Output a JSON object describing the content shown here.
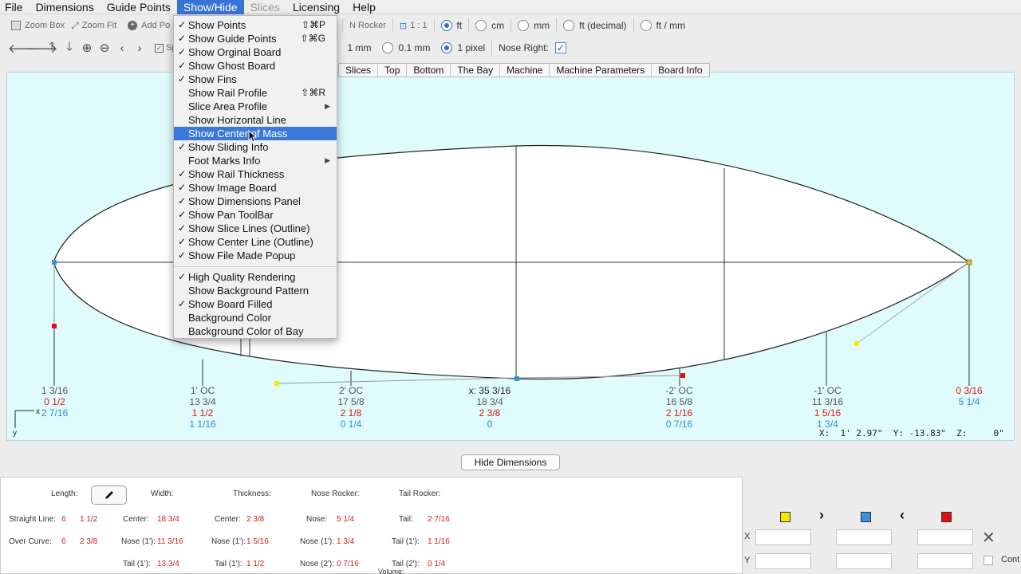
{
  "menubar": {
    "items": [
      "File",
      "Dimensions",
      "Guide Points",
      "Show/Hide",
      "Slices",
      "Licensing",
      "Help"
    ]
  },
  "toolbar1": {
    "zoom_box": "Zoom Box",
    "zoom_fit": "Zoom Fit",
    "add_point": "Add Po",
    "hidden_er": "er",
    "n_rocker": "N Rocker",
    "scale": "1 : 1",
    "units": [
      "ft",
      "cm",
      "mm",
      "ft (decimal)",
      "ft / mm"
    ],
    "selected_unit": "ft"
  },
  "toolbar2": {
    "sp": "Sp",
    "precision": [
      "1 mm",
      "0.1 mm",
      "1 pixel"
    ],
    "selected_precision": "1 pixel",
    "nose_right_label": "Nose Right:",
    "nose_right_checked": true
  },
  "tabs": [
    "Slices",
    "Top",
    "Bottom",
    "The Bay",
    "Machine",
    "Machine Parameters",
    "Board Info"
  ],
  "canvas": {
    "axis_x": "x",
    "axis_y": "y",
    "measurements": [
      {
        "label": "1 3/16",
        "red": "0 1/2",
        "blue": "2 7/16",
        "extra": ""
      },
      {
        "label": "1' OC",
        "gray2": "13 3/4",
        "red": "1 1/2",
        "blue": "1 1/16"
      },
      {
        "label": "2' OC",
        "gray2": "17 5/8",
        "red": "2 1/8",
        "blue": "0 1/4"
      },
      {
        "label": "x: 35 3/16",
        "gray2": "18 3/4",
        "red": "2 3/8",
        "blue": "0"
      },
      {
        "label": "-2' OC",
        "gray2": "16 5/8",
        "red": "2 1/16",
        "blue": "0 7/16"
      },
      {
        "label": "-1' OC",
        "gray2": "11 3/16",
        "red": "1 5/16",
        "blue": "1 3/4"
      },
      {
        "label": "",
        "red": "0 3/16",
        "blue": "5 1/4"
      }
    ],
    "coords_text": "X:  1' 2.97\"  Y: -13.83\"  Z:     0\""
  },
  "hide_dimensions_button": "Hide Dimensions",
  "dimensions_panel": {
    "length_label": "Length:",
    "width_label": "Width:",
    "thickness_label": "Thickness:",
    "nose_rocker_label": "Nose Rocker:",
    "tail_rocker_label": "Tail Rocker:",
    "straight_line_label": "Straight Line:",
    "straight_line_ft": "6",
    "straight_line_in": "1 1/2",
    "over_curve_label": "Over Curve:",
    "over_curve_ft": "6",
    "over_curve_in": "2 3/8",
    "width_center_label": "Center:",
    "width_center": "18 3/4",
    "width_nose_label": "Nose (1'):",
    "width_nose": "11 3/16",
    "width_tail_label": "Tail (1'):",
    "width_tail": "13 3/4",
    "thick_center_label": "Center:",
    "thick_center": "2 3/8",
    "thick_nose_label": "Nose (1'):",
    "thick_nose": "1 5/16",
    "thick_tail_label": "Tail (1'):",
    "thick_tail": "1 1/2",
    "nr_nose_label": "Nose:",
    "nr_nose": "5 1/4",
    "nr_nose1_label": "Nose (1'):",
    "nr_nose1": "1 3/4",
    "nr_nose2_label": "Nose (2'):",
    "nr_nose2": "0 7/16",
    "tr_tail_label": "Tail:",
    "tr_tail": "2 7/16",
    "tr_tail1_label": "Tail (1'):",
    "tr_tail1": "1 1/16",
    "tr_tail2_label": "Tail (2'):",
    "tr_tail2": "0 1/4",
    "volume_label": "Volume:"
  },
  "right_panel": {
    "x_label": "X",
    "y_label": "Y",
    "cont_label": "Cont",
    "colors": {
      "yellow": "#f8e600",
      "blue": "#3a8fdc",
      "red": "#e01010"
    }
  },
  "show_hide_menu": {
    "items": [
      {
        "label": "Show Points",
        "checked": true,
        "shortcut": "⇧⌘P"
      },
      {
        "label": "Show Guide Points",
        "checked": true,
        "shortcut": "⇧⌘G"
      },
      {
        "label": "Show Orginal Board",
        "checked": true
      },
      {
        "label": "Show Ghost Board",
        "checked": true
      },
      {
        "label": "Show Fins",
        "checked": true
      },
      {
        "label": "Show Rail Profile",
        "checked": false,
        "shortcut": "⇧⌘R"
      },
      {
        "label": "Slice Area Profile",
        "checked": false,
        "submenu": true
      },
      {
        "label": "Show Horizontal Line",
        "checked": false
      },
      {
        "label": "Show Center of Mass",
        "checked": false,
        "highlighted": true
      },
      {
        "label": "Show Sliding Info",
        "checked": true
      },
      {
        "label": "Foot Marks Info",
        "checked": false,
        "submenu": true
      },
      {
        "label": "Show Rail Thickness",
        "checked": true
      },
      {
        "label": "Show Image Board",
        "checked": true
      },
      {
        "label": "Show Dimensions Panel",
        "checked": true
      },
      {
        "label": "Show Pan ToolBar",
        "checked": true
      },
      {
        "label": "Show Slice Lines (Outline)",
        "checked": true
      },
      {
        "label": "Show Center Line (Outline)",
        "checked": true
      },
      {
        "label": "Show File Made Popup",
        "checked": true
      }
    ],
    "items2": [
      {
        "label": "High Quality Rendering",
        "checked": true
      },
      {
        "label": "Show Background Pattern",
        "checked": false
      },
      {
        "label": "Show Board Filled",
        "checked": true
      },
      {
        "label": "Background Color",
        "checked": false
      },
      {
        "label": "Background Color of Bay",
        "checked": false
      }
    ]
  }
}
